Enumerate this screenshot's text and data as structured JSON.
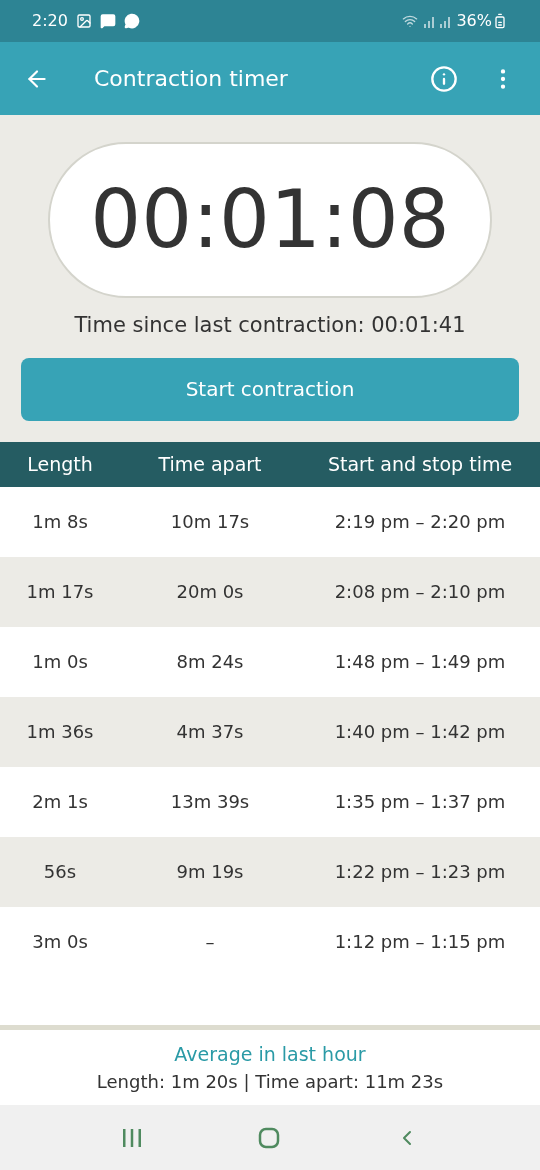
{
  "status_bar": {
    "time": "2:20",
    "battery": "36%"
  },
  "app_bar": {
    "title": "Contraction timer"
  },
  "timer": {
    "value": "00:01:08",
    "since_label": "Time since last contraction: 00:01:41"
  },
  "start_button": {
    "label": "Start contraction"
  },
  "table": {
    "columns": [
      "Length",
      "Time apart",
      "Start and stop time"
    ],
    "rows": [
      {
        "length": "1m 8s",
        "apart": "10m 17s",
        "times": "2:19 pm – 2:20 pm"
      },
      {
        "length": "1m 17s",
        "apart": "20m 0s",
        "times": "2:08 pm – 2:10 pm"
      },
      {
        "length": "1m 0s",
        "apart": "8m 24s",
        "times": "1:48 pm – 1:49 pm"
      },
      {
        "length": "1m 36s",
        "apart": "4m 37s",
        "times": "1:40 pm – 1:42 pm"
      },
      {
        "length": "2m 1s",
        "apart": "13m 39s",
        "times": "1:35 pm – 1:37 pm"
      },
      {
        "length": "56s",
        "apart": "9m 19s",
        "times": "1:22 pm – 1:23 pm"
      },
      {
        "length": "3m 0s",
        "apart": "–",
        "times": "1:12 pm – 1:15 pm"
      }
    ]
  },
  "summary": {
    "title": "Average in last hour",
    "text": "Length: 1m 20s | Time apart: 11m 23s"
  }
}
